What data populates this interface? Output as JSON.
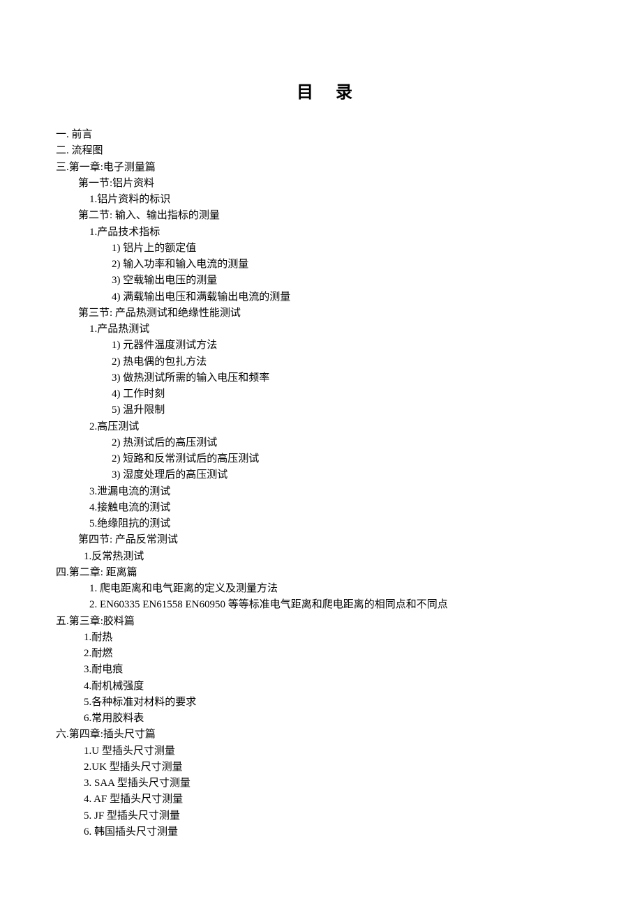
{
  "title": "目录",
  "items": [
    {
      "cls": "lvl0",
      "text": "一. 前言"
    },
    {
      "cls": "lvl0",
      "text": "二. 流程图"
    },
    {
      "cls": "lvl0",
      "text": "三.第一章:电子测量篇"
    },
    {
      "cls": "lvl1",
      "text": "第一节:铝片资料"
    },
    {
      "cls": "lvl2",
      "text": "1.铝片资料的标识"
    },
    {
      "cls": "lvl1",
      "text": "第二节: 输入、输出指标的测量"
    },
    {
      "cls": "lvl2",
      "text": "1.产品技术指标"
    },
    {
      "cls": "lvl3",
      "text": "1)  铝片上的额定值"
    },
    {
      "cls": "lvl3",
      "text": "2)  输入功率和输入电流的测量"
    },
    {
      "cls": "lvl3",
      "text": "3)  空载输出电压的测量"
    },
    {
      "cls": "lvl3",
      "text": "4)  满载输出电压和满载输出电流的测量"
    },
    {
      "cls": "lvl1",
      "text": "第三节: 产品热测试和绝缘性能测试"
    },
    {
      "cls": "lvl2",
      "text": "1.产品热测试"
    },
    {
      "cls": "lvl3",
      "text": "1)  元器件温度测试方法"
    },
    {
      "cls": "lvl3",
      "text": "2)  热电偶的包扎方法"
    },
    {
      "cls": "lvl3",
      "text": "3)  做热测试所需的输入电压和频率"
    },
    {
      "cls": "lvl3",
      "text": "4)  工作时刻"
    },
    {
      "cls": "lvl3",
      "text": "5)  温升限制"
    },
    {
      "cls": "lvl2",
      "text": "2.高压测试"
    },
    {
      "cls": "lvl3",
      "text": "2)  热测试后的高压测试"
    },
    {
      "cls": "lvl3",
      "text": "2) 短路和反常测试后的高压测试"
    },
    {
      "cls": "lvl3",
      "text": "3) 湿度处理后的高压测试"
    },
    {
      "cls": "lvl2",
      "text": "3.泄漏电流的测试"
    },
    {
      "cls": "lvl2",
      "text": "4.接触电流的测试"
    },
    {
      "cls": "lvl2",
      "text": "5.绝缘阻抗的测试"
    },
    {
      "cls": "lvl1",
      "text": "第四节: 产品反常测试"
    },
    {
      "cls": "lvl1b",
      "text": "1.反常热测试"
    },
    {
      "cls": "lvl0",
      "text": "四.第二章: 距离篇"
    },
    {
      "cls": "lvl1c",
      "text": "1.  爬电距离和电气距离的定义及测量方法"
    },
    {
      "cls": "lvl1c",
      "text": "2.  EN60335 EN61558 EN60950 等等标准电气距离和爬电距离的相同点和不同点"
    },
    {
      "cls": "lvl0",
      "text": "五.第三章:胶料篇"
    },
    {
      "cls": "lvl1b",
      "text": "1.耐热"
    },
    {
      "cls": "lvl1b",
      "text": "2.耐燃"
    },
    {
      "cls": "lvl1b",
      "text": "3.耐电痕"
    },
    {
      "cls": "lvl1b",
      "text": "4.耐机械强度"
    },
    {
      "cls": "lvl1b",
      "text": "5.各种标准对材料的要求"
    },
    {
      "cls": "lvl1b",
      "text": "6.常用胶料表"
    },
    {
      "cls": "lvl0",
      "text": "六.第四章:插头尺寸篇"
    },
    {
      "cls": "lvl1b",
      "text": "1.U 型插头尺寸测量"
    },
    {
      "cls": "lvl1b",
      "text": "2.UK 型插头尺寸测量"
    },
    {
      "cls": "lvl1b",
      "text": "3.  SAA 型插头尺寸测量"
    },
    {
      "cls": "lvl1b",
      "text": "4.  AF 型插头尺寸测量"
    },
    {
      "cls": "lvl1b",
      "text": "5.  JF 型插头尺寸测量"
    },
    {
      "cls": "lvl1b",
      "text": "6.  韩国插头尺寸测量"
    }
  ]
}
